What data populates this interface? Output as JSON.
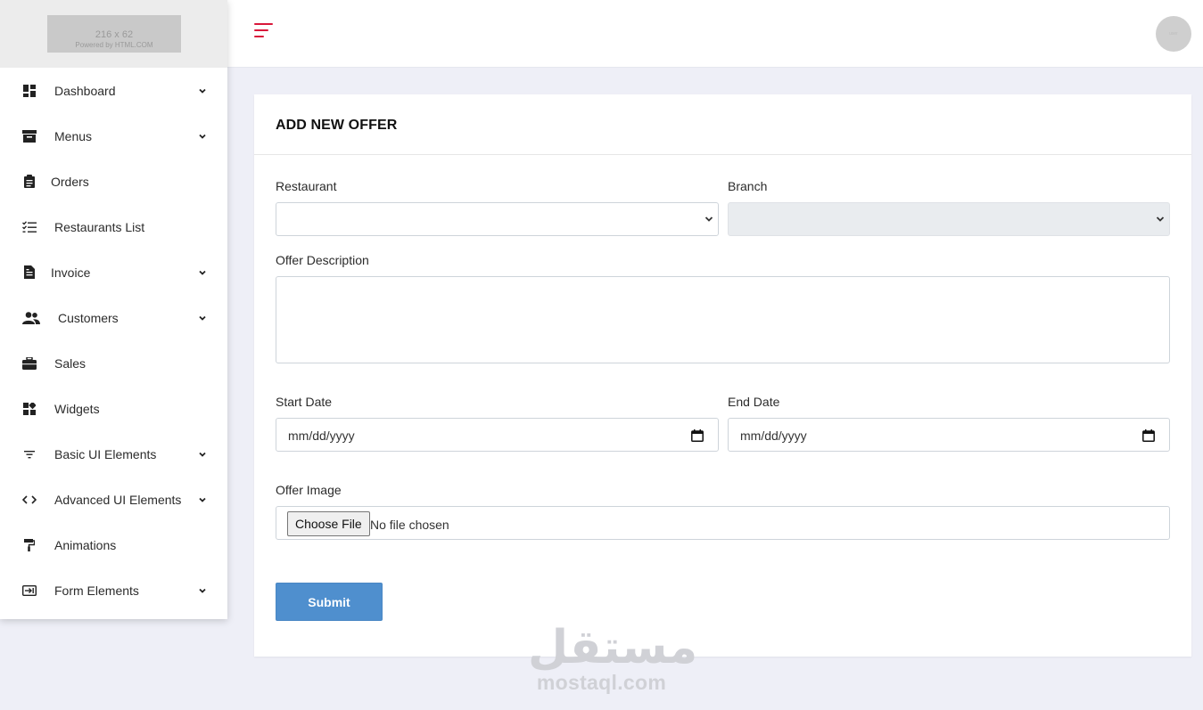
{
  "logo": {
    "size_text": "216 x 62",
    "powered_text": "Powered by HTML.COM"
  },
  "topbar": {
    "avatar_text": "user"
  },
  "sidebar": {
    "items": [
      {
        "label": "Dashboard",
        "icon": "dashboard-icon",
        "has_submenu": true
      },
      {
        "label": "Menus",
        "icon": "archive-icon",
        "has_submenu": true
      },
      {
        "label": "Orders",
        "icon": "clipboard-icon",
        "has_submenu": false
      },
      {
        "label": "Restaurants List",
        "icon": "checklist-icon",
        "has_submenu": false
      },
      {
        "label": "Invoice",
        "icon": "document-icon",
        "has_submenu": true
      },
      {
        "label": "Customers",
        "icon": "users-icon",
        "has_submenu": true
      },
      {
        "label": "Sales",
        "icon": "briefcase-icon",
        "has_submenu": false
      },
      {
        "label": "Widgets",
        "icon": "widgets-icon",
        "has_submenu": false
      },
      {
        "label": "Basic UI Elements",
        "icon": "filter-icon",
        "has_submenu": true
      },
      {
        "label": "Advanced UI Elements",
        "icon": "code-icon",
        "has_submenu": true
      },
      {
        "label": "Animations",
        "icon": "paint-roller-icon",
        "has_submenu": false
      },
      {
        "label": "Form Elements",
        "icon": "login-icon",
        "has_submenu": true
      }
    ]
  },
  "form": {
    "title": "ADD NEW OFFER",
    "restaurant_label": "Restaurant",
    "restaurant_value": "",
    "branch_label": "Branch",
    "branch_value": "",
    "description_label": "Offer Description",
    "description_value": "",
    "start_date_label": "Start Date",
    "start_date_placeholder": "mm/dd/yyyy",
    "end_date_label": "End Date",
    "end_date_placeholder": "mm/dd/yyyy",
    "image_label": "Offer Image",
    "choose_file_label": "Choose File",
    "no_file_text": "No file chosen",
    "submit_label": "Submit"
  },
  "watermark": {
    "arabic": "مستقل",
    "latin": "mostaql.com"
  },
  "colors": {
    "accent": "#d9173a",
    "submit": "#4f8fce",
    "background": "#eeeff7"
  }
}
